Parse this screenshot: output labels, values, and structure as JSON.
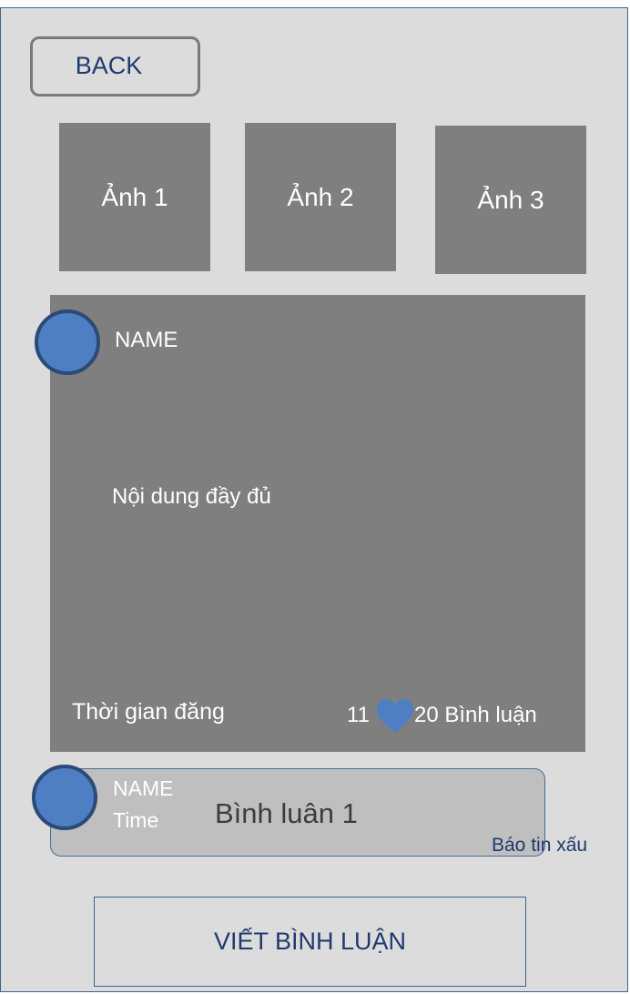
{
  "header": {
    "back_label": "BACK"
  },
  "photos": [
    {
      "label": "Ảnh 1"
    },
    {
      "label": "Ảnh 2"
    },
    {
      "label": "Ảnh 3"
    }
  ],
  "post": {
    "author_name": "NAME",
    "content": "Nội dung đầy đủ",
    "post_time": "Thời gian đăng",
    "likes_count": "11",
    "comments_text": "20 Bình luận"
  },
  "comment": {
    "author_name": "NAME",
    "time": "Time",
    "text": "Bình luân 1",
    "report_label": "Báo tin xấu"
  },
  "footer": {
    "write_comment_label": "VIẾT BÌNH LUẬN"
  },
  "colors": {
    "background": "#dcdcdc",
    "placeholder_gray": "#7f7f7f",
    "accent_blue": "#4f7fc3",
    "link_navy": "#1f3a6e"
  }
}
